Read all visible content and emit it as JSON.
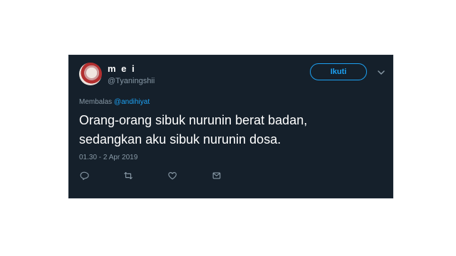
{
  "tweet": {
    "display_name": "m e i",
    "handle": "@Tyaningshii",
    "follow_label": "Ikuti",
    "reply_prefix": "Membalas",
    "reply_mention": "@andihiyat",
    "text": "Orang-orang sibuk nurunin berat badan,\nsedangkan aku sibuk nurunin dosa.",
    "timestamp": "01.30 - 2 Apr 2019"
  },
  "icons": {
    "menu": "chevron-down-icon",
    "reply": "reply-icon",
    "retweet": "retweet-icon",
    "like": "heart-icon",
    "message": "message-icon"
  },
  "colors": {
    "card_background": "#15202b",
    "accent": "#1da1f2",
    "secondary_text": "#8899a6",
    "primary_text": "#ffffff"
  }
}
